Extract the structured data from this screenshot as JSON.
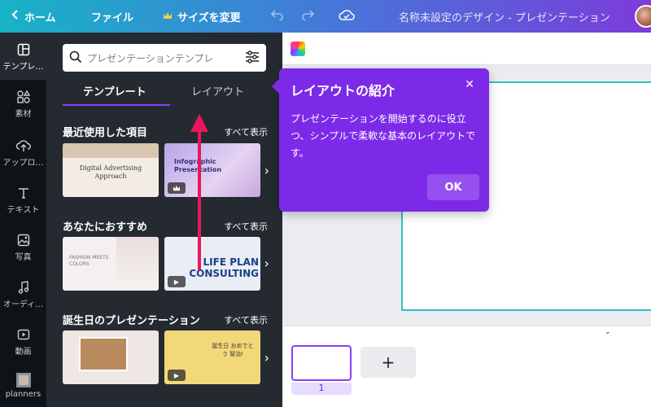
{
  "topbar": {
    "home": "ホーム",
    "file": "ファイル",
    "resize": "サイズを変更",
    "title": "名称未設定のデザイン - プレゼンテーション"
  },
  "leftnav": [
    {
      "label": "テンプレ…",
      "icon": "template-icon"
    },
    {
      "label": "素材",
      "icon": "elements-icon"
    },
    {
      "label": "アップロ…",
      "icon": "upload-icon"
    },
    {
      "label": "テキスト",
      "icon": "text-icon"
    },
    {
      "label": "写真",
      "icon": "photo-icon"
    },
    {
      "label": "オーディ…",
      "icon": "audio-icon"
    },
    {
      "label": "動画",
      "icon": "video-icon"
    },
    {
      "label": "planners",
      "icon": "planners-icon"
    }
  ],
  "panel": {
    "search_placeholder": "プレゼンテーションテンプレ",
    "tabs": {
      "templates": "テンプレート",
      "layout": "レイアウト"
    },
    "sections": [
      {
        "title": "最近使用した項目",
        "see_all": "すべて表示"
      },
      {
        "title": "あなたにおすすめ",
        "see_all": "すべて表示"
      },
      {
        "title": "誕生日のプレゼンテーション",
        "see_all": "すべて表示"
      }
    ],
    "thumbs": {
      "t1": "Digital Advertising Approach",
      "t2": "Infographic Presentation",
      "t3": "FASHION MEETS COLORS",
      "t4": "LIFE PLAN CONSULTING",
      "t6": "誕生日 おめでとう 智治!"
    }
  },
  "popup": {
    "title": "レイアウトの紹介",
    "body": "プレゼンテーションを開始するのに役立つ、シンプルで柔軟な基本のレイアウトです。",
    "ok": "OK"
  },
  "bottom": {
    "page_number": "1",
    "add": "+"
  },
  "colors": {
    "accent": "#8b3dff",
    "popup": "#7d2ae8",
    "panel": "#252a31",
    "nav": "#0e1318",
    "annotation_arrow": "#e8175d"
  }
}
